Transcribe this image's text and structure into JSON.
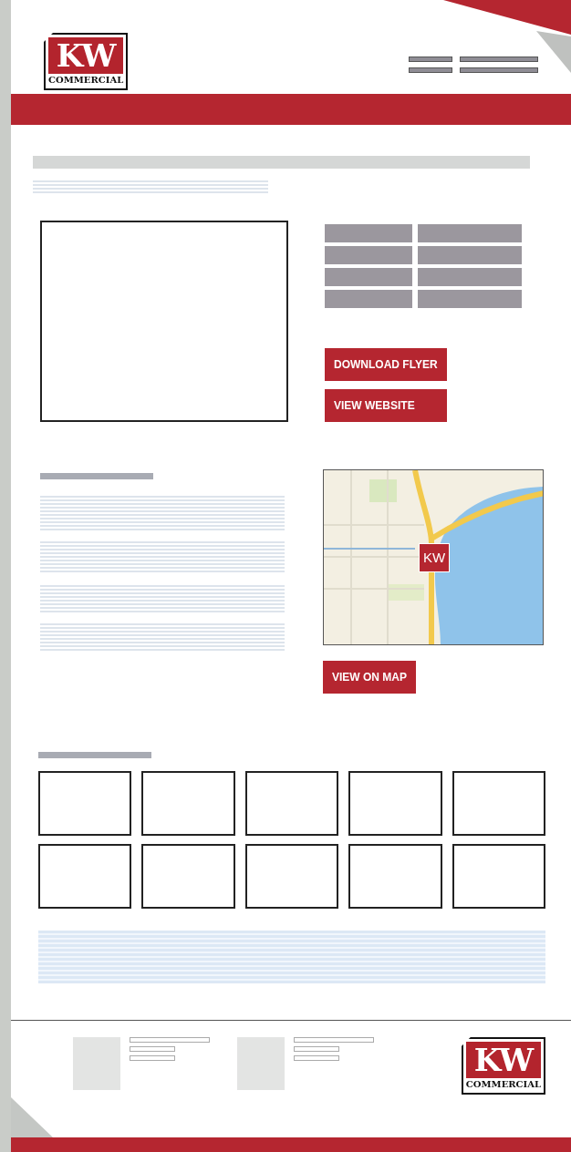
{
  "header": {
    "logo": {
      "mark": "KW",
      "tagline": "COMMERCIAL"
    }
  },
  "property": {
    "buttons": [
      "DOWNLOAD FLYER",
      "VIEW WEBSITE"
    ]
  },
  "location": {
    "map_marker": "KW",
    "button": "VIEW ON MAP"
  },
  "footer": {
    "logo": {
      "mark": "KW",
      "tagline": "COMMERCIAL"
    }
  }
}
